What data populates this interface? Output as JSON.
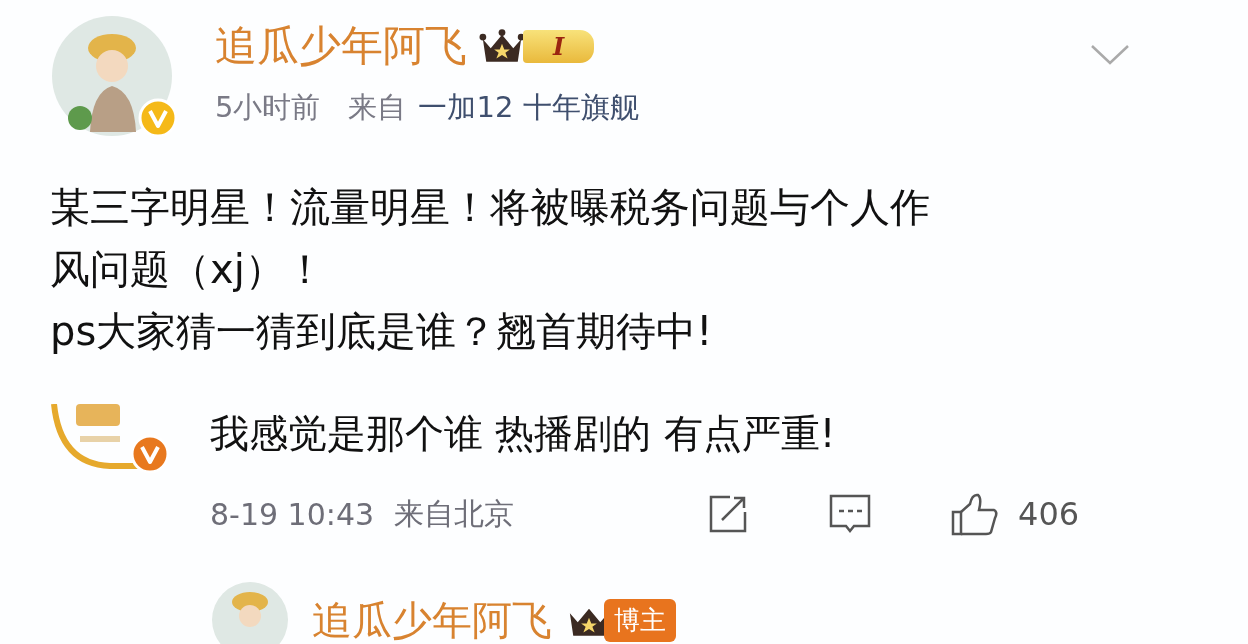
{
  "post": {
    "author": {
      "name": "追瓜少年阿飞",
      "level_badge": "I"
    },
    "time": "5小时前",
    "source_prefix": "来自",
    "source": "一加12 十年旗舰",
    "text_lines": [
      "某三字明星！流量明星！将被曝税务问题与个人作",
      "风问题（xj）！",
      "ps大家猜一猜到底是谁？翘首期待中!"
    ]
  },
  "comment": {
    "text": "我感觉是那个谁 热播剧的 有点严重!",
    "time": "8-19 10:43",
    "location": "来自北京",
    "likes": "406"
  },
  "reply": {
    "author": {
      "name": "追瓜少年阿飞",
      "badge": "博主"
    }
  }
}
